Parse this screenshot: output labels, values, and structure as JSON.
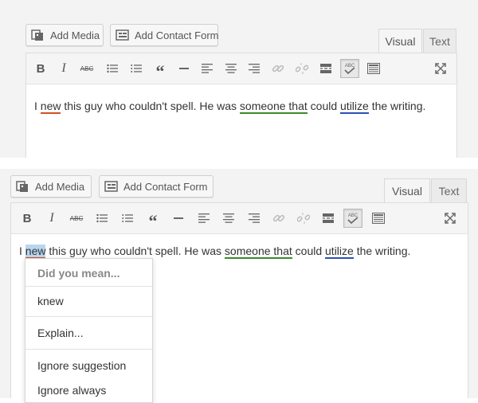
{
  "buttons": {
    "add_media": "Add Media",
    "add_contact_form": "Add Contact Form"
  },
  "tabs": {
    "visual": "Visual",
    "text": "Text"
  },
  "toolbar_glyphs": {
    "bold": "B",
    "italic": "I",
    "strike": "ABC",
    "quote": "“"
  },
  "sentence": {
    "p1": "I ",
    "w1": "new",
    "p2": " this guy who couldn't spell. He was ",
    "w2": "someone that",
    "p3": " could ",
    "w3": "utilize",
    "p4": " the writing."
  },
  "menu": {
    "title": "Did you mean...",
    "suggestion": "knew",
    "explain": "Explain...",
    "ignore_suggestion": "Ignore suggestion",
    "ignore_always": "Ignore always"
  },
  "colors": {
    "red_underline": "#d54e21",
    "green_underline": "#3a8a2a",
    "blue_underline": "#2c4fb3",
    "selection": "#b9d6ef"
  },
  "icons": [
    "add-media-icon",
    "contact-form-icon",
    "bullet-list-icon",
    "numbered-list-icon",
    "horizontal-rule-icon",
    "align-left-icon",
    "align-center-icon",
    "align-right-icon",
    "link-icon",
    "unlink-icon",
    "read-more-icon",
    "proofread-icon",
    "kitchen-sink-icon",
    "fullscreen-icon"
  ]
}
